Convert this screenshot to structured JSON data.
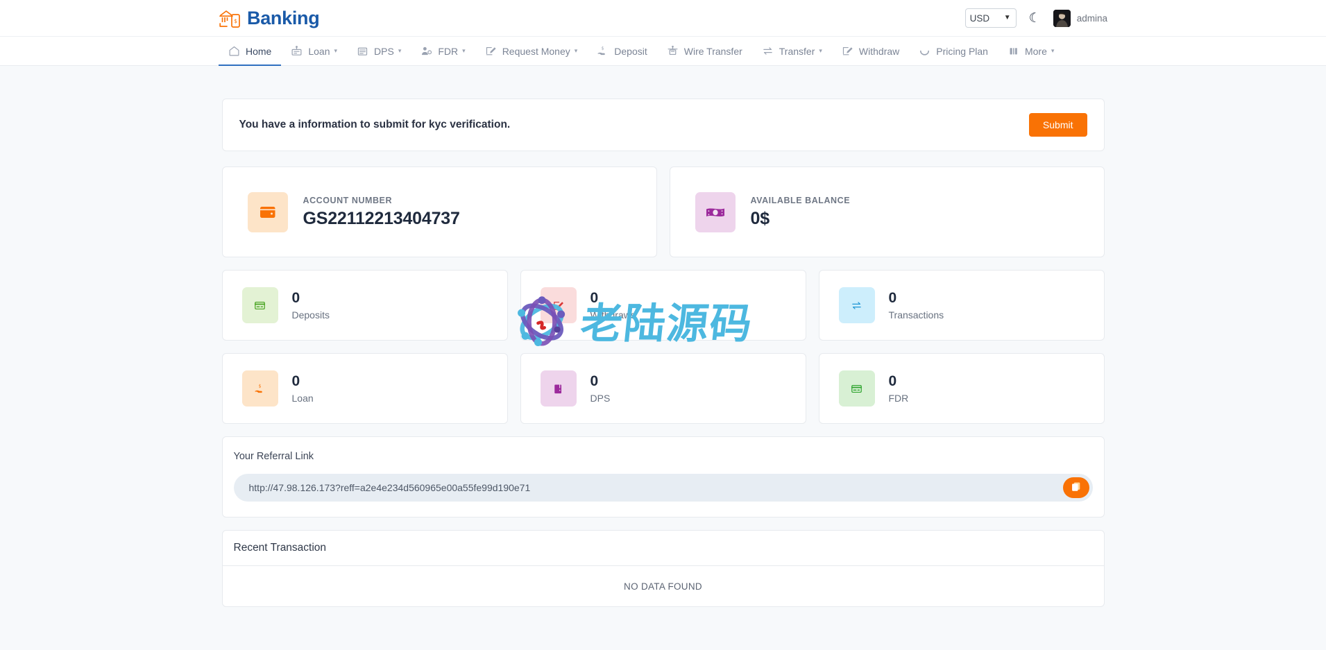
{
  "brand": {
    "name": "Banking",
    "logo_icon": "bank-mobile-icon"
  },
  "topbar": {
    "currency": {
      "selected": "USD",
      "options": [
        "USD"
      ],
      "caret_icon": "chevron-down-icon"
    },
    "theme_toggle_icon": "moon-icon",
    "avatar_icon": "user-avatar",
    "username": "admina"
  },
  "nav": {
    "items": [
      {
        "label": "Home",
        "icon": "home-icon",
        "caret": false,
        "active": true
      },
      {
        "label": "Loan",
        "icon": "loan-icon",
        "caret": true,
        "active": false
      },
      {
        "label": "DPS",
        "icon": "bank-icon",
        "caret": true,
        "active": false
      },
      {
        "label": "FDR",
        "icon": "user-shield-icon",
        "caret": true,
        "active": false
      },
      {
        "label": "Request Money",
        "icon": "request-money-icon",
        "caret": true,
        "active": false
      },
      {
        "label": "Deposit",
        "icon": "hand-money-icon",
        "caret": false,
        "active": false
      },
      {
        "label": "Wire Transfer",
        "icon": "wire-transfer-icon",
        "caret": false,
        "active": false
      },
      {
        "label": "Transfer",
        "icon": "exchange-icon",
        "caret": true,
        "active": false
      },
      {
        "label": "Withdraw",
        "icon": "withdraw-icon",
        "caret": false,
        "active": false
      },
      {
        "label": "Pricing Plan",
        "icon": "pricing-plan-icon",
        "caret": false,
        "active": false
      },
      {
        "label": "More",
        "icon": "more-icon",
        "caret": true,
        "active": false
      }
    ]
  },
  "kyc": {
    "message": "You have a information to submit for kyc verification.",
    "submit_label": "Submit",
    "submit_color": "#f97205"
  },
  "account": {
    "label": "ACCOUNT NUMBER",
    "value": "GS22112213404737",
    "icon": "wallet-icon",
    "icon_bg": "#fde4c8",
    "icon_color": "#f97205"
  },
  "balance": {
    "label": "AVAILABLE BALANCE",
    "value": "0$",
    "icon": "money-note-icon",
    "icon_bg": "#eed4ec",
    "icon_color": "#9c2a9c"
  },
  "stats": [
    {
      "value": "0",
      "label": "Deposits",
      "icon": "credit-card-icon",
      "icon_bg": "#e3f2d4",
      "icon_color": "#46a31e"
    },
    {
      "value": "0",
      "label": "Withdraws",
      "icon": "withdraw-box-icon",
      "icon_bg": "#fadcdc",
      "icon_color": "#d93636"
    },
    {
      "value": "0",
      "label": "Transactions",
      "icon": "exchange-icon",
      "icon_bg": "#cdeefc",
      "icon_color": "#2096d4"
    },
    {
      "value": "0",
      "label": "Loan",
      "icon": "hand-money-icon",
      "icon_bg": "#fde4c8",
      "icon_color": "#f97205"
    },
    {
      "value": "0",
      "label": "DPS",
      "icon": "book-icon",
      "icon_bg": "#eed4ec",
      "icon_color": "#9c2a9c"
    },
    {
      "value": "0",
      "label": "FDR",
      "icon": "credit-card-icon",
      "icon_bg": "#d8f0d4",
      "icon_color": "#2fa42f"
    }
  ],
  "referral": {
    "title": "Your Referral Link",
    "link": "http://47.98.126.173?reff=a2e4e234d560965e00a55fe99d190e71",
    "copy_icon": "copy-icon"
  },
  "recent": {
    "title": "Recent Transaction",
    "empty_text": "NO DATA FOUND"
  },
  "watermark": {
    "text": "老陆源码",
    "logo_icon": "atom-logo-icon",
    "color": "#4db8e0"
  }
}
